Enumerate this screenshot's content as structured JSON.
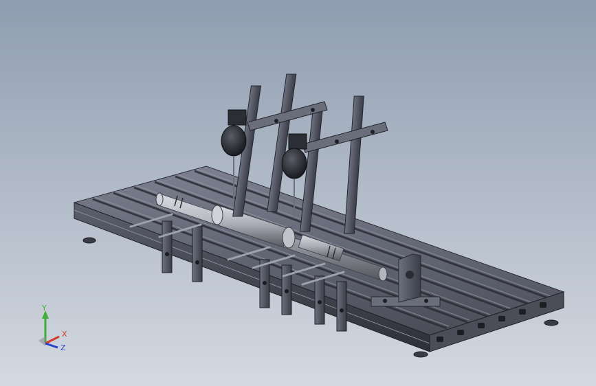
{
  "viewport": {
    "background_top": "#8f9db0",
    "background_bottom": "#d4d9e1"
  },
  "triad": {
    "y_label": "Y",
    "x_label": "X",
    "z_label": "Z",
    "y_color": "#3fae3a",
    "x_color": "#d23a2a",
    "z_color": "#2a3fc8"
  },
  "model": {
    "icon": "cad-assembly-icon"
  }
}
